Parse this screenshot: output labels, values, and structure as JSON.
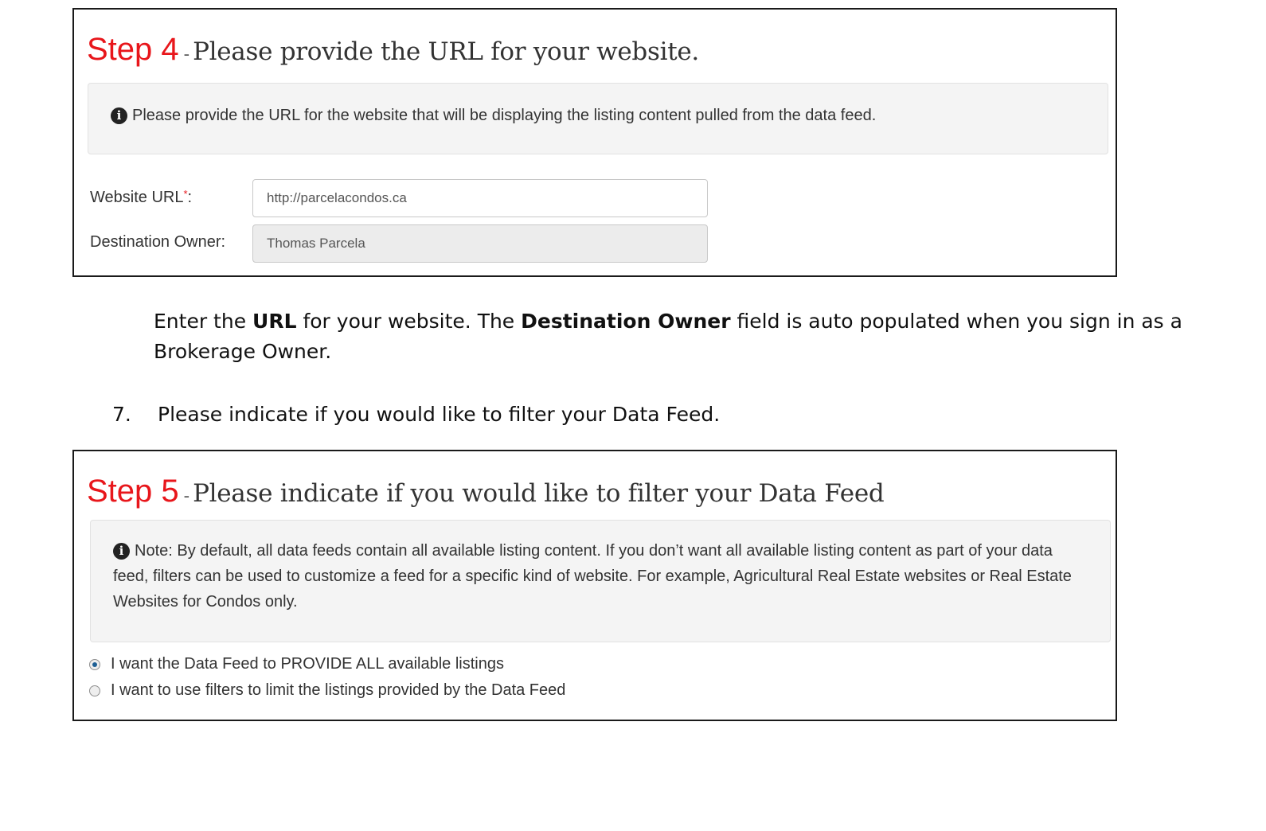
{
  "step4": {
    "step_label": "Step 4",
    "dash": "-",
    "title": "Please provide the URL for your website.",
    "info_text": "Please provide the URL for the website that will be displaying the listing content pulled from the data feed.",
    "fields": {
      "website_url": {
        "label": "Website URL",
        "required_mark": "*",
        "suffix": ":",
        "value": "http://parcelacondos.ca"
      },
      "destination_owner": {
        "label": "Destination Owner:",
        "value": "Thomas Parcela"
      }
    }
  },
  "instructions": {
    "para_part1": "Enter the ",
    "para_bold1": "URL",
    "para_part2": " for your website. The ",
    "para_bold2": "Destination Owner",
    "para_part3": " field is auto populated when you sign in as a Brokerage Owner.",
    "item_number": "7.",
    "item_text": "Please indicate if you would like to filter your Data Feed."
  },
  "step5": {
    "step_label": "Step 5",
    "dash": "-",
    "title": "Please indicate if you would like to filter your Data Feed",
    "info_text": "Note: By default, all data feeds contain all available listing content. If you don’t want all available listing content as part of your data feed, filters can be used to customize a feed for a specific kind of website. For example, Agricultural Real Estate websites or Real Estate Websites for Condos only.",
    "options": [
      {
        "label": "I want the Data Feed to PROVIDE ALL available listings",
        "selected": true
      },
      {
        "label": "I want to use filters to limit the listings provided by the Data Feed",
        "selected": false
      }
    ]
  },
  "colors": {
    "step_accent": "#e8161b",
    "radio_selected": "#1d5f94",
    "infobox_bg": "#f4f4f4"
  },
  "icons": {
    "info": "info-circle-icon"
  }
}
